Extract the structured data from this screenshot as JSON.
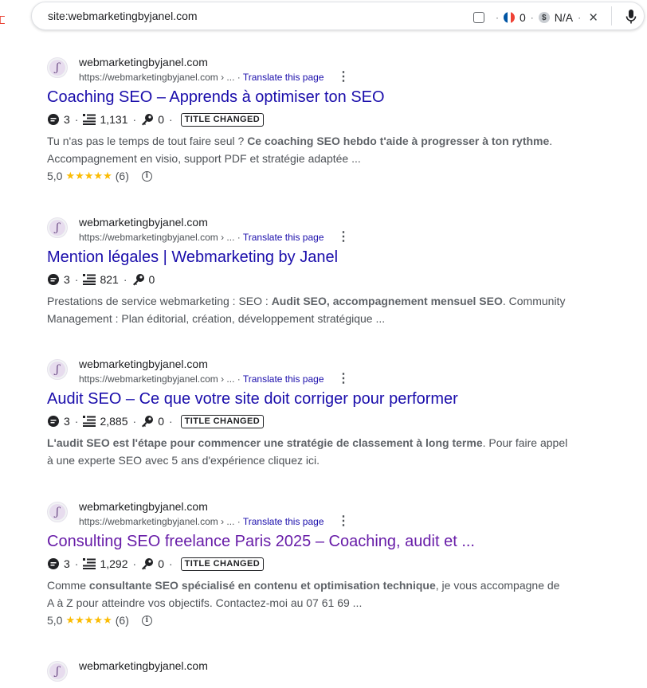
{
  "search": {
    "query": "site:webmarketingbyjanel.com",
    "lang_count": "0",
    "price_value": "N/A",
    "separator": "·"
  },
  "results": [
    {
      "site_name": "webmarketingbyjanel.com",
      "url": "https://webmarketingbyjanel.com › ...",
      "translate": "Translate this page",
      "title": "Coaching SEO – Apprends à optimiser ton SEO",
      "comments": "3",
      "words": "1,131",
      "keys": "0",
      "badge": "TITLE CHANGED",
      "snippet_parts": [
        {
          "text": "Tu n'as pas le temps de tout faire seul ? ",
          "bold": false
        },
        {
          "text": "Ce coaching SEO hebdo t'aide à progresser à ton rythme",
          "bold": true
        },
        {
          "text": ". Accompagnement en visio, support PDF et stratégie adaptée ...",
          "bold": false
        }
      ],
      "rating": "5,0",
      "stars": "★★★★★",
      "rating_count": "(6)"
    },
    {
      "site_name": "webmarketingbyjanel.com",
      "url": "https://webmarketingbyjanel.com › ...",
      "translate": "Translate this page",
      "title": "Mention légales | Webmarketing by Janel",
      "comments": "3",
      "words": "821",
      "keys": "0",
      "badge": "",
      "snippet_parts": [
        {
          "text": "Prestations de service webmarketing : SEO : ",
          "bold": false
        },
        {
          "text": "Audit SEO, accompagnement mensuel SEO",
          "bold": true
        },
        {
          "text": ". Community Management : Plan éditorial, création, développement stratégique ...",
          "bold": false
        }
      ]
    },
    {
      "site_name": "webmarketingbyjanel.com",
      "url": "https://webmarketingbyjanel.com › ...",
      "translate": "Translate this page",
      "title": "Audit SEO – Ce que votre site doit corriger pour performer",
      "comments": "3",
      "words": "2,885",
      "keys": "0",
      "badge": "TITLE CHANGED",
      "snippet_parts": [
        {
          "text": "L'audit SEO est l'étape pour commencer une stratégie de classement à long terme",
          "bold": true
        },
        {
          "text": ". Pour faire appel à une experte SEO avec 5 ans d'expérience cliquez ici.",
          "bold": false
        }
      ]
    },
    {
      "site_name": "webmarketingbyjanel.com",
      "url": "https://webmarketingbyjanel.com › ...",
      "translate": "Translate this page",
      "title": "Consulting SEO freelance Paris 2025 – Coaching, audit et ...",
      "comments": "3",
      "words": "1,292",
      "keys": "0",
      "badge": "TITLE CHANGED",
      "snippet_parts": [
        {
          "text": "Comme ",
          "bold": false
        },
        {
          "text": "consultante SEO spécialisé en contenu et optimisation technique",
          "bold": true
        },
        {
          "text": ", je vous accompagne de A à Z pour atteindre vos objectifs. Contactez-moi au 07 61 69 ...",
          "bold": false
        }
      ],
      "rating": "5,0",
      "stars": "★★★★★",
      "rating_count": "(6)"
    },
    {
      "site_name": "webmarketingbyjanel.com"
    }
  ],
  "colors": {
    "link": "#1a0dab",
    "visited_link": "#681da8",
    "star": "#fbbc04"
  }
}
